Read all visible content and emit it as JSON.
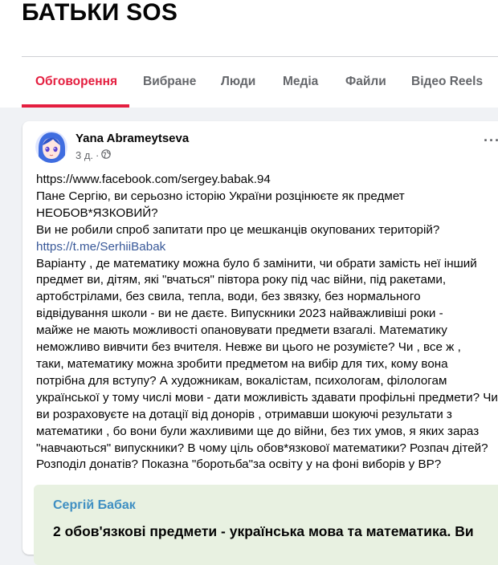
{
  "group": {
    "title": "БАТЬКИ SOS"
  },
  "tabs": [
    {
      "label": "Обговорення",
      "active": true
    },
    {
      "label": "Вибране"
    },
    {
      "label": "Люди"
    },
    {
      "label": "Медіа"
    },
    {
      "label": "Файли"
    },
    {
      "label": "Відео Reels"
    }
  ],
  "colors": {
    "accent": "#e41e3f",
    "link": "#385898",
    "muted": "#65676b",
    "embed_bg": "#e8f1e1",
    "embed_author": "#3f8fc2"
  },
  "post": {
    "author": "Yana Abrameytseva",
    "time": "3 д.",
    "separator": "·",
    "privacy_icon": "globe-icon",
    "more_icon": "more-options-icon",
    "more_label": "···",
    "lines": [
      {
        "text": "https://www.facebook.com/sergey.babak.94"
      },
      {
        "text": "Пане Сергію, ви серьозно історію України  розцінюєте  як предмет"
      },
      {
        "text": "НЕОБОВ*ЯЗКОВИЙ?"
      },
      {
        "text": "Ви не робили спроб запитати про це мешканців окупованих територій?"
      },
      {
        "text": "https://t.me/SerhiiBabak",
        "link": true
      },
      {
        "text": "Варіанту , де математику можна було б замінити, чи обрати замість неї інший"
      },
      {
        "text": "предмет ви, дітям, які \"вчаться\" півтора року  під час війни, під ракетами,"
      },
      {
        "text": "артобстрілами, без свила, тепла, води, без звязку, без нормального"
      },
      {
        "text": "відвідування школи  -  ви не даєте. Випускники 2023 найважливіші роки -"
      },
      {
        "text": "майже не мають можливості опановувати предмети взагалі.  Математику"
      },
      {
        "text": "неможливо вивчити без вчителя. Невже ви цього не розумієте? Чи , все ж ,"
      },
      {
        "text": "таки, математику можна зробити предметом на вибір для тих, кому вона"
      },
      {
        "text": "потрібна для вступу? А художникам, вокалістам, психологам, філологам"
      },
      {
        "text": "української у тому числі мови - дати можливість здавати профільні предмети? Чи"
      },
      {
        "text": "ви розраховуєте на дотації від донорів , отримавши шокуючі  результати  з"
      },
      {
        "text": "математики , бо вони були жахливими ще до війни, без тих умов, я яких зараз"
      },
      {
        "text": "\"навчаються\" випускники? В чому ціль обов*язкової математики? Розпач дітей?"
      },
      {
        "text": "Розподіл донатів? Показна \"боротьба\"за освіту у на фоні виборів у ВР?"
      }
    ],
    "embed": {
      "author": "Сергій Бабак",
      "text": "2 обов'язкові предмети - українська мова та математика. Ви"
    }
  }
}
